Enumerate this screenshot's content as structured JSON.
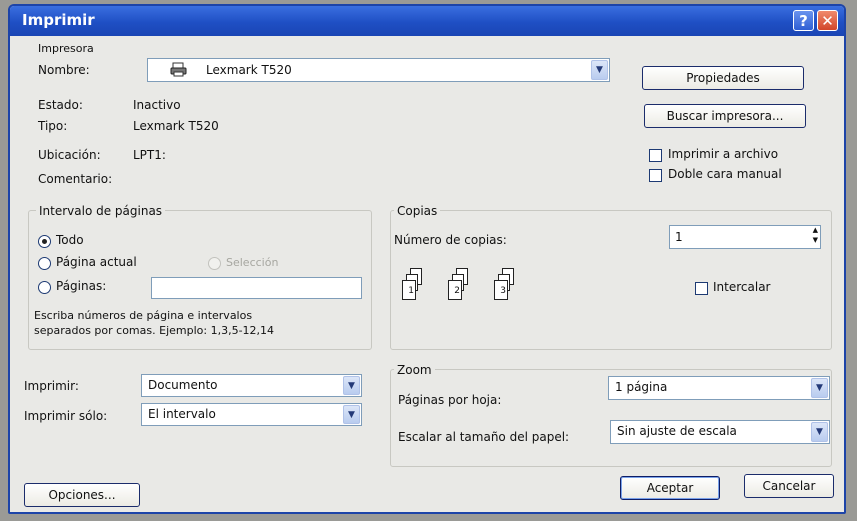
{
  "window": {
    "title": "Imprimir",
    "help_glyph": "?",
    "close_glyph": "✕"
  },
  "printer": {
    "group_label": "Impresora",
    "name_label": "Nombre:",
    "name_value": "Lexmark T520",
    "status_label": "Estado:",
    "status_value": "Inactivo",
    "type_label": "Tipo:",
    "type_value": "Lexmark T520",
    "location_label": "Ubicación:",
    "location_value": "LPT1:",
    "comment_label": "Comentario:",
    "properties_button": "Propiedades",
    "find_printer_button": "Buscar impresora...",
    "print_to_file_label": "Imprimir a archivo",
    "print_to_file_checked": false,
    "manual_duplex_label": "Doble cara manual",
    "manual_duplex_checked": false
  },
  "page_range": {
    "group_label": "Intervalo de páginas",
    "all_label": "Todo",
    "current_page_label": "Página actual",
    "selection_label": "Selección",
    "pages_label": "Páginas:",
    "pages_value": "",
    "selected": "all",
    "hint_line1": "Escriba números de página e intervalos",
    "hint_line2": "separados por comas. Ejemplo: 1,3,5-12,14"
  },
  "copies": {
    "group_label": "Copias",
    "number_label": "Número de copias:",
    "number_value": "1",
    "collate_label": "Intercalar",
    "collate_checked": false,
    "page_numbers": [
      "1",
      "2",
      "3"
    ]
  },
  "print_what": {
    "label": "Imprimir:",
    "value": "Documento"
  },
  "print_only": {
    "label": "Imprimir sólo:",
    "value": "El intervalo"
  },
  "zoom": {
    "group_label": "Zoom",
    "pages_per_sheet_label": "Páginas por hoja:",
    "pages_per_sheet_value": "1 página",
    "scale_label": "Escalar al tamaño del papel:",
    "scale_value": "Sin ajuste de escala"
  },
  "footer": {
    "options_button": "Opciones...",
    "ok_button": "Aceptar",
    "cancel_button": "Cancelar"
  },
  "icons": {
    "dropdown_arrow": "▼",
    "spin_up": "▲",
    "spin_down": "▼",
    "printer_icon": "printer-icon"
  }
}
